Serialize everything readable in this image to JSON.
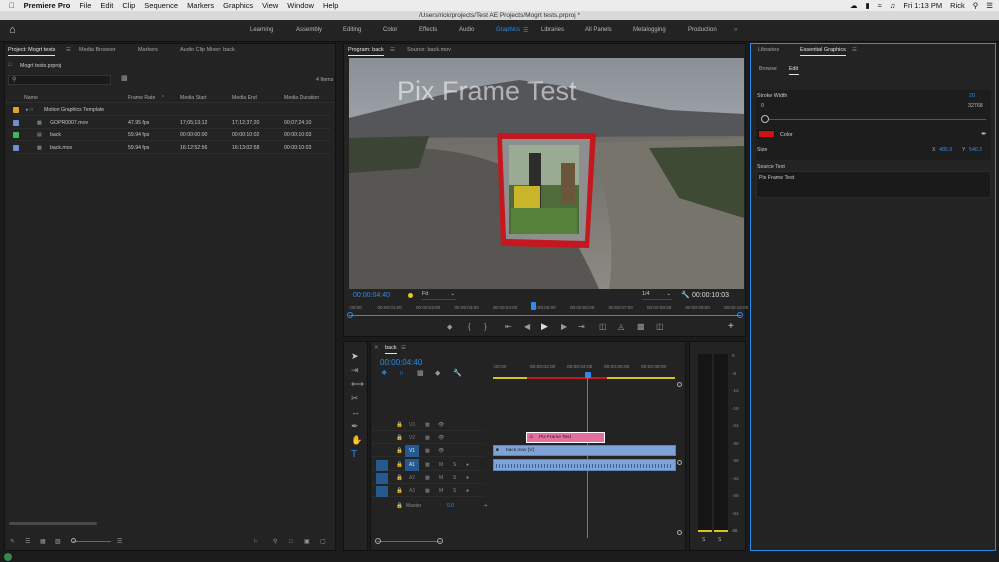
{
  "menubar": {
    "app_name": "Premiere Pro",
    "items": [
      "File",
      "Edit",
      "Clip",
      "Sequence",
      "Markers",
      "Graphics",
      "View",
      "Window",
      "Help"
    ],
    "clock": "Fri 1:13 PM",
    "user": "Rick"
  },
  "window_title": "/Users/rick/projects/Test AE Projects/Mogrt tests.prproj *",
  "workspaces": [
    "Learning",
    "Assembly",
    "Editing",
    "Color",
    "Effects",
    "Audio",
    "Graphics",
    "Libraries",
    "All Panels",
    "Metalogging",
    "Production"
  ],
  "active_workspace": "Graphics",
  "project_panel": {
    "tabs": [
      "Project: Mogrt tests",
      "Media Browser",
      "Markers",
      "Audio Clip Mixer: back"
    ],
    "filename": "Mogrt tests.prproj",
    "item_count": "4 Items",
    "columns": [
      "Name",
      "Frame Rate",
      "Media Start",
      "Media End",
      "Media Duration"
    ],
    "rows": [
      {
        "name": "Motion Graphics Template",
        "rate": "",
        "start": "",
        "end": "",
        "dur": "",
        "color": "#e5a22b",
        "type": "folder"
      },
      {
        "name": "GOPR0007.mov",
        "rate": "47.95 fps",
        "start": "17;05;13;12",
        "end": "17;12;37;20",
        "dur": "00;07;24;10",
        "color": "#6e8fd0",
        "type": "clip"
      },
      {
        "name": "back",
        "rate": "59.94 fps",
        "start": "00:00:00:00",
        "end": "00:00:10:02",
        "dur": "00:00:10:03",
        "color": "#3fb85a",
        "type": "sequence"
      },
      {
        "name": "back.mov",
        "rate": "59.94 fps",
        "start": "16:12:52:56",
        "end": "16:13:02:58",
        "dur": "00:00:10:03",
        "color": "#6e8fd0",
        "type": "clip"
      }
    ]
  },
  "program_panel": {
    "tabs": [
      "Program: back",
      "Source: back.mov"
    ],
    "overlay_title": "Pix Frame Test",
    "timecode": "00:00:04:40",
    "fit": "Fit",
    "resolution": "1/4",
    "duration": "00:00:10:03",
    "ruler_labels": [
      ":00:00",
      "00:00:01:00",
      "00:00:02:00",
      "00:00:03:00",
      "00:00:04:00",
      "00:00:05:00",
      "00:00:06:00",
      "00:00:07:00",
      "00:00:08:00",
      "00:00:09:00",
      "00:00:10:00"
    ]
  },
  "timeline": {
    "sequence_name": "back",
    "timecode": "00:00:04:40",
    "ruler_labels": [
      ":00:00",
      "00:00:02:00",
      "00:00:04:00",
      "00:00:06:00",
      "00:00:08:00"
    ],
    "video_tracks": [
      "V3",
      "V2",
      "V1"
    ],
    "audio_tracks": [
      "A1",
      "A2",
      "A3"
    ],
    "master_label": "Master",
    "master_value": "0.0",
    "clip_graphic": "Pix Frame Test",
    "clip_video": "back.mov [V]"
  },
  "audio_meter": {
    "scale": [
      "0",
      "-6",
      "-12",
      "-18",
      "-24",
      "-30",
      "-36",
      "-42",
      "-48",
      "-54",
      "dB"
    ],
    "solo": [
      "S",
      "S"
    ]
  },
  "essential_graphics": {
    "tabs": [
      "Libraries",
      "Essential Graphics"
    ],
    "subtabs": [
      "Browse",
      "Edit"
    ],
    "stroke_width_label": "Stroke Width",
    "stroke_width_value": "20",
    "slider_min": "0",
    "slider_max": "32768",
    "color_label": "Color",
    "color_value": "#d40f16",
    "size_label": "Size",
    "x_label": "X",
    "x_value": "485.9",
    "y_label": "Y",
    "y_value": "540.2",
    "source_text_label": "Source Text",
    "source_text_value": "Pix Frame Test"
  }
}
